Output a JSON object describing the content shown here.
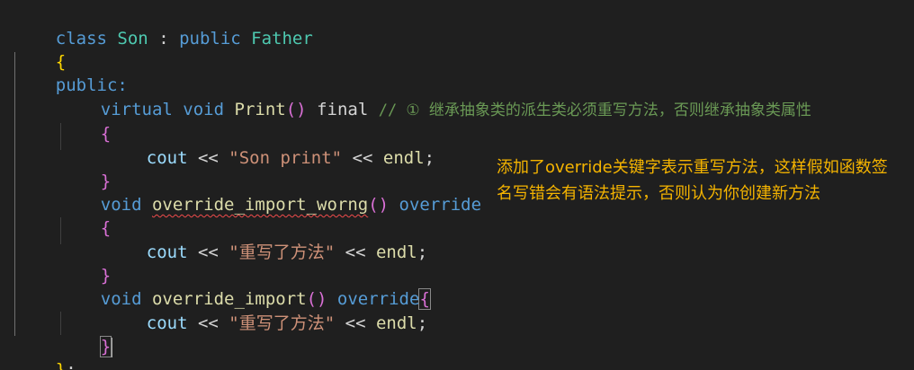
{
  "editor": {
    "line1": {
      "kw_class": "class",
      "name": "Son",
      "colon": " : ",
      "kw_public": "public",
      "base": "Father"
    },
    "line2": {
      "brace": "{"
    },
    "line3": {
      "access": "public:"
    },
    "line4": {
      "kw_virtual": "virtual",
      "kw_void": "void",
      "fn": "Print",
      "parens": "()",
      "kw_final": "final",
      "comment": "// ① 继承抽象类的派生类必须重写方法，否则继承抽象类属性"
    },
    "line5": {
      "brace": "{"
    },
    "line6": {
      "cout": "cout",
      "op1": " << ",
      "str": "\"Son print\"",
      "op2": " << ",
      "endl": "endl",
      "semi": ";"
    },
    "line7": {
      "brace": "}"
    },
    "line8": {
      "kw_void": "void",
      "fn": "override_import_worng",
      "parens": "()",
      "kw_override": "override"
    },
    "line9": {
      "brace": "{"
    },
    "line10": {
      "cout": "cout",
      "op1": " << ",
      "str": "\"重写了方法\"",
      "op2": " << ",
      "endl": "endl",
      "semi": ";"
    },
    "line11": {
      "brace": "}"
    },
    "line12": {
      "kw_void": "void",
      "fn": "override_import",
      "parens": "()",
      "kw_override": "override",
      "brace": "{"
    },
    "line13": {
      "cout": "cout",
      "op1": " << ",
      "str": "\"重写了方法\"",
      "op2": " << ",
      "endl": "endl",
      "semi": ";"
    },
    "line14": {
      "brace": "}"
    },
    "line15": {
      "brace": "}",
      "semi": ";"
    }
  },
  "annotation": {
    "text": "添加了override关键字表示重写方法，这样假如函数签名写错会有语法提示，否则认为你创建新方法"
  },
  "colors": {
    "background": "#1f1f1f",
    "keyword": "#569cd6",
    "type": "#4ec9b0",
    "function": "#dcdcaa",
    "string": "#ce9178",
    "comment": "#6a9955",
    "annotation": "#f5b400"
  }
}
